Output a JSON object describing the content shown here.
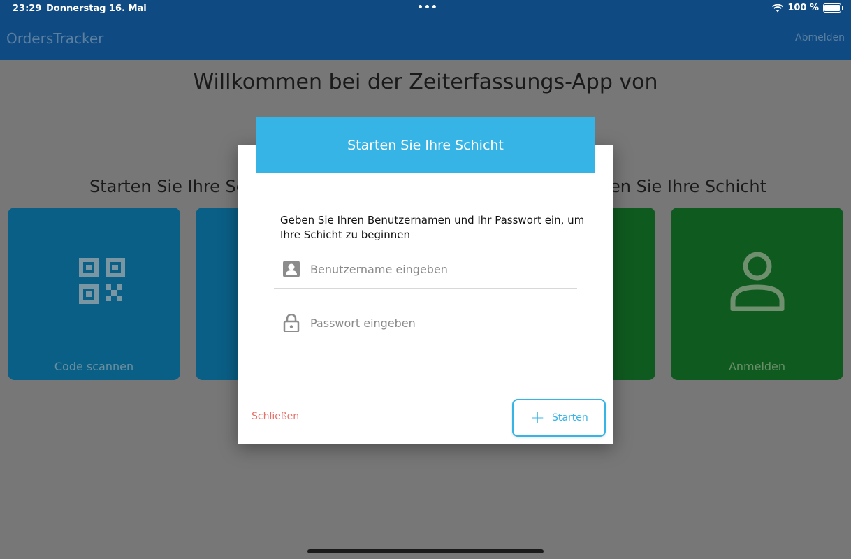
{
  "status_bar": {
    "time": "23:29",
    "date": "Donnerstag 16. Mai",
    "battery": "100 %"
  },
  "app": {
    "title": "OrdersTracker",
    "logout": "Abmelden"
  },
  "welcome": "Willkommen bei der Zeiterfassungs-App von",
  "section": {
    "left_title": "Starten Sie Ihre Sc",
    "right_title": "en Sie Ihre Schicht"
  },
  "tiles": {
    "scan_label": "Code scannen",
    "login_label": "Anmelden"
  },
  "colors": {
    "header_blue": "#0f4a82",
    "dialog_accent": "#36b4e6",
    "tile_blue": "#0a5f86",
    "tile_green": "#0f5a1f",
    "close_red": "#e8706a"
  },
  "dialog": {
    "title": "Starten Sie Ihre Schicht",
    "instruction": "Geben Sie Ihren Benutzernamen und Ihr Passwort ein, um Ihre Schicht zu beginnen",
    "username_placeholder": "Benutzername eingeben",
    "password_placeholder": "Passwort eingeben",
    "close_label": "Schließen",
    "start_label": "Starten",
    "username_icon": "account-box-icon",
    "password_icon": "lock-icon"
  }
}
